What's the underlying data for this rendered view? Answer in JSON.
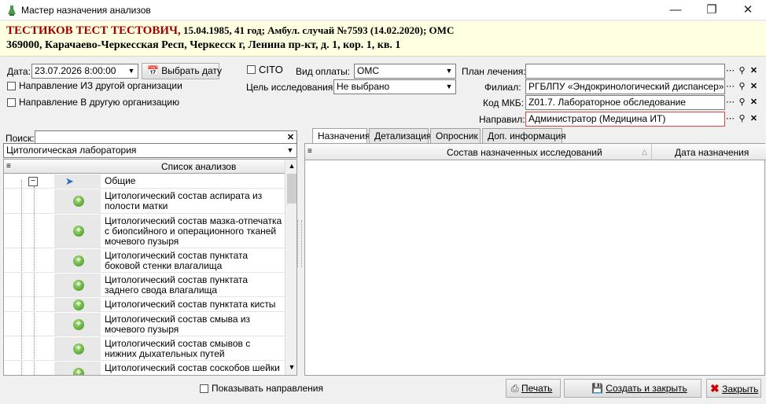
{
  "window": {
    "title": "Мастер назначения анализов"
  },
  "patient": {
    "name": "ТЕСТИКОВ ТЕСТ ТЕСТОВИЧ,",
    "info": " 15.04.1985, 41 год; Амбул. случай №7593 (14.02.2020); ОМС",
    "address": "369000, Карачаево-Черкесская Респ, Черкесск г, Ленина пр-кт, д. 1, кор. 1, кв. 1"
  },
  "form": {
    "date_label": "Дата:",
    "date_value": "23.07.2026 8:00:00",
    "choose_date_button": "Выбрать дату",
    "cito_label": "CITO",
    "payment_label": "Вид оплаты:",
    "payment_value": "ОМС",
    "purpose_label": "Цель исследования:",
    "purpose_value": "Не выбрано",
    "from_other_org": "Направление ИЗ другой организации",
    "to_other_org": "Направление В другую организацию",
    "plan_label": "План лечения:",
    "plan_value": "",
    "branch_label": "Филиал:",
    "branch_value": "РГБЛПУ «Эндокринологический диспансер»",
    "mkb_label": "Код МКБ:",
    "mkb_value": "Z01.7. Лабораторное обследование",
    "sent_by_label": "Направил:",
    "sent_by_value": "Администратор (Медицина ИТ)"
  },
  "left_panel": {
    "search_label": "Поиск:",
    "search_value": "",
    "lab_value": "Цитологическая лаборатория",
    "list_header": "Список анализов",
    "group": "Общие",
    "items": [
      "Цитологический состав аспирата из полости матки",
      "Цитологический состав мазка-отпечатка с биопсийного и операционного тканей мочевого пузыря",
      "Цитологический состав пунктата боковой стенки влагалища",
      "Цитологический состав пунктата заднего свода влагалища",
      "Цитологический состав пунктата кисты",
      "Цитологический состав смыва из мочевого пузыря",
      "Цитологический состав смывов с нижних дыхательных путей",
      "Цитологический состав соскобов шейки матки и цервикального канала"
    ]
  },
  "right_panel": {
    "tabs": [
      "Назначения",
      "Детализация",
      "Опросник",
      "Доп. информация"
    ],
    "columns": [
      "Состав назначенных исследований",
      "Дата назначения"
    ]
  },
  "bottom": {
    "show_directions": "Показывать направления",
    "print_button": "Печать",
    "create_close_button": "Создать и закрыть",
    "close_button": "Закрыть"
  }
}
